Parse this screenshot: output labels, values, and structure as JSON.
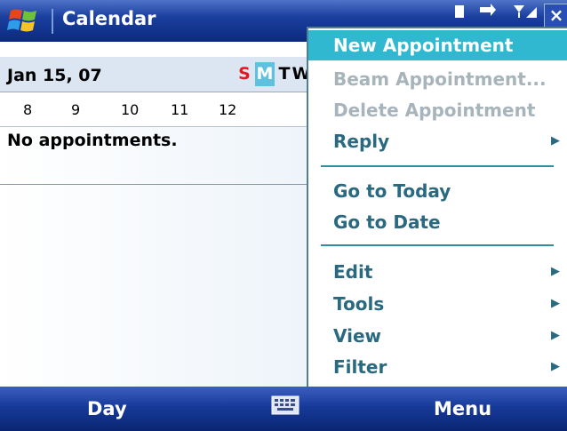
{
  "titlebar": {
    "app_title": "Calendar",
    "close_label": "×"
  },
  "date_row": {
    "date": "Jan 15, 07",
    "weekdays": [
      "S",
      "M",
      "T",
      "W"
    ],
    "selected_weekday": "M"
  },
  "hours": [
    "8",
    "9",
    "10",
    "11",
    "12"
  ],
  "body": {
    "empty_message": "No appointments."
  },
  "menu": {
    "items": [
      {
        "label": "New Appointment",
        "state": "selected",
        "submenu": false
      },
      {
        "label": "Beam Appointment...",
        "state": "disabled",
        "submenu": false
      },
      {
        "label": "Delete Appointment",
        "state": "disabled",
        "submenu": false
      },
      {
        "label": "Reply",
        "state": "normal",
        "submenu": true
      },
      {
        "label": "Go to Today",
        "state": "normal",
        "submenu": false
      },
      {
        "label": "Go to Date",
        "state": "normal",
        "submenu": false
      },
      {
        "label": "Edit",
        "state": "normal",
        "submenu": true
      },
      {
        "label": "Tools",
        "state": "normal",
        "submenu": true
      },
      {
        "label": "View",
        "state": "normal",
        "submenu": true
      },
      {
        "label": "Filter",
        "state": "normal",
        "submenu": true
      }
    ],
    "submenu_glyph": "▶"
  },
  "softkeys": {
    "left": "Day",
    "right": "Menu"
  },
  "colors": {
    "accent": "#2fb8cf",
    "titlebar": "#1a3f9e",
    "weekend": "#e0191f",
    "menu_text": "#2a6a80",
    "disabled_text": "#a8b4bc"
  },
  "icons": [
    "windows-start-icon",
    "connectivity-icon",
    "signal-icon",
    "close-icon",
    "keyboard-icon",
    "submenu-arrow-icon"
  ]
}
